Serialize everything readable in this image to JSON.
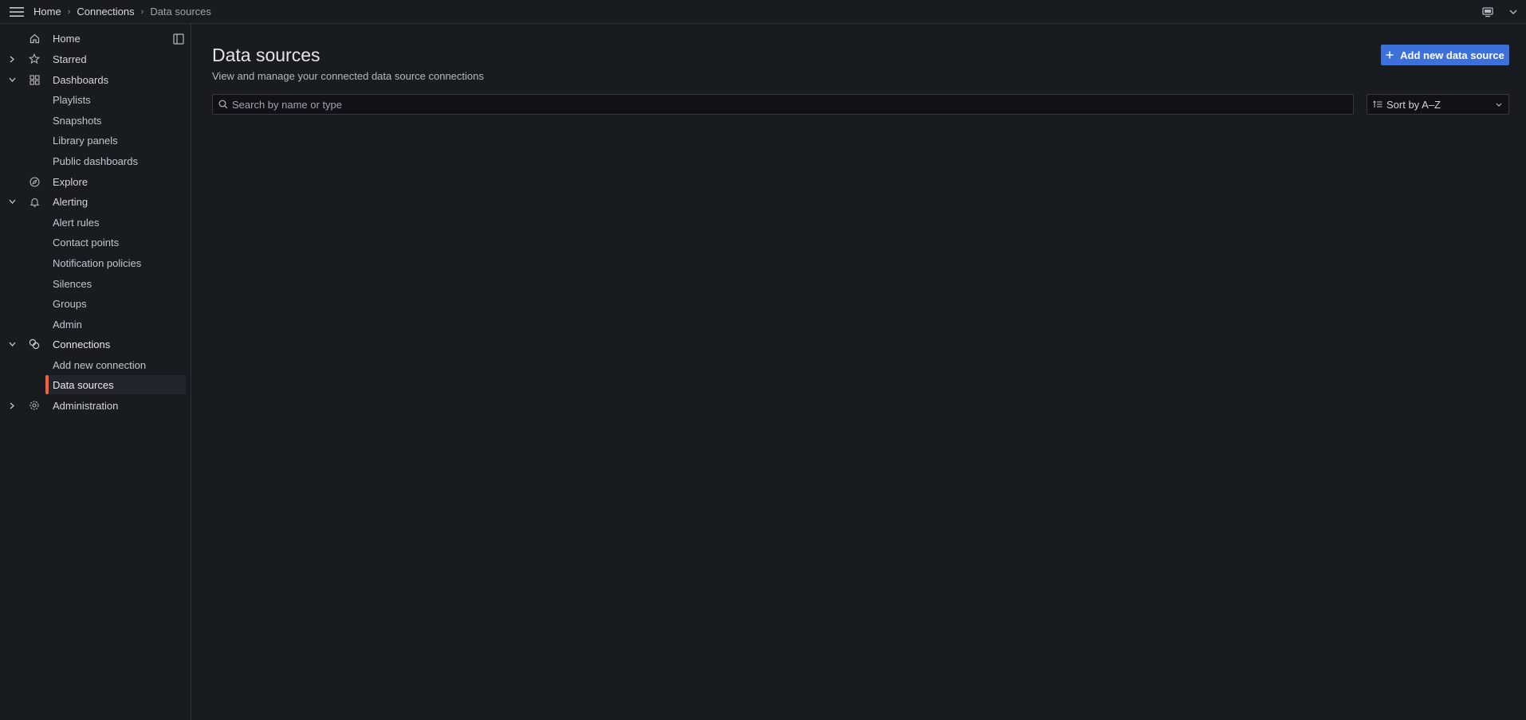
{
  "breadcrumb": {
    "items": [
      "Home",
      "Connections",
      "Data sources"
    ]
  },
  "sidebar": {
    "items": [
      {
        "label": "Home",
        "icon": "home-icon"
      },
      {
        "label": "Starred",
        "icon": "star-icon",
        "expandable": true,
        "expanded": false
      },
      {
        "label": "Dashboards",
        "icon": "apps-icon",
        "expandable": true,
        "expanded": true
      },
      {
        "label": "Playlists",
        "sub": true
      },
      {
        "label": "Snapshots",
        "sub": true
      },
      {
        "label": "Library panels",
        "sub": true
      },
      {
        "label": "Public dashboards",
        "sub": true
      },
      {
        "label": "Explore",
        "icon": "compass-icon"
      },
      {
        "label": "Alerting",
        "icon": "bell-icon",
        "expandable": true,
        "expanded": true
      },
      {
        "label": "Alert rules",
        "sub": true
      },
      {
        "label": "Contact points",
        "sub": true
      },
      {
        "label": "Notification policies",
        "sub": true
      },
      {
        "label": "Silences",
        "sub": true
      },
      {
        "label": "Groups",
        "sub": true
      },
      {
        "label": "Admin",
        "sub": true
      },
      {
        "label": "Connections",
        "icon": "connections-icon",
        "expandable": true,
        "expanded": true
      },
      {
        "label": "Add new connection",
        "sub": true
      },
      {
        "label": "Data sources",
        "sub": true,
        "active": true
      },
      {
        "label": "Administration",
        "icon": "cog-icon",
        "expandable": true,
        "expanded": false
      }
    ]
  },
  "main": {
    "title": "Data sources",
    "subtitle": "View and manage your connected data source connections",
    "add_button": "Add new data source",
    "search_placeholder": "Search by name or type",
    "sort_label": "Sort by A–Z"
  },
  "colors": {
    "accent": "#3d71d9",
    "active_bar": "#f55f3e",
    "background": "#181b1f"
  }
}
